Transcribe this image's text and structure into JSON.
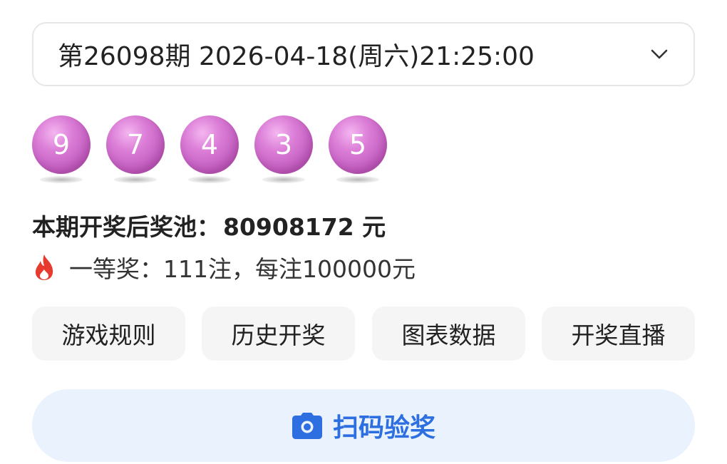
{
  "draw_select": {
    "label": "第26098期 2026-04-18(周六)21:25:00",
    "icon": "chevron-down-icon"
  },
  "balls": [
    "9",
    "7",
    "4",
    "3",
    "5"
  ],
  "ball_color": "#cd6cc9",
  "pool": {
    "label": "本期开奖后奖池：",
    "amount": "80908172 元"
  },
  "first_prize": {
    "icon": "fire-icon",
    "text": "一等奖：111注，每注100000元"
  },
  "actions": {
    "rules": "游戏规则",
    "history": "历史开奖",
    "charts": "图表数据",
    "live": "开奖直播"
  },
  "scan": {
    "icon": "camera-icon",
    "label": "扫码验奖",
    "accent": "#2d6ee0"
  }
}
